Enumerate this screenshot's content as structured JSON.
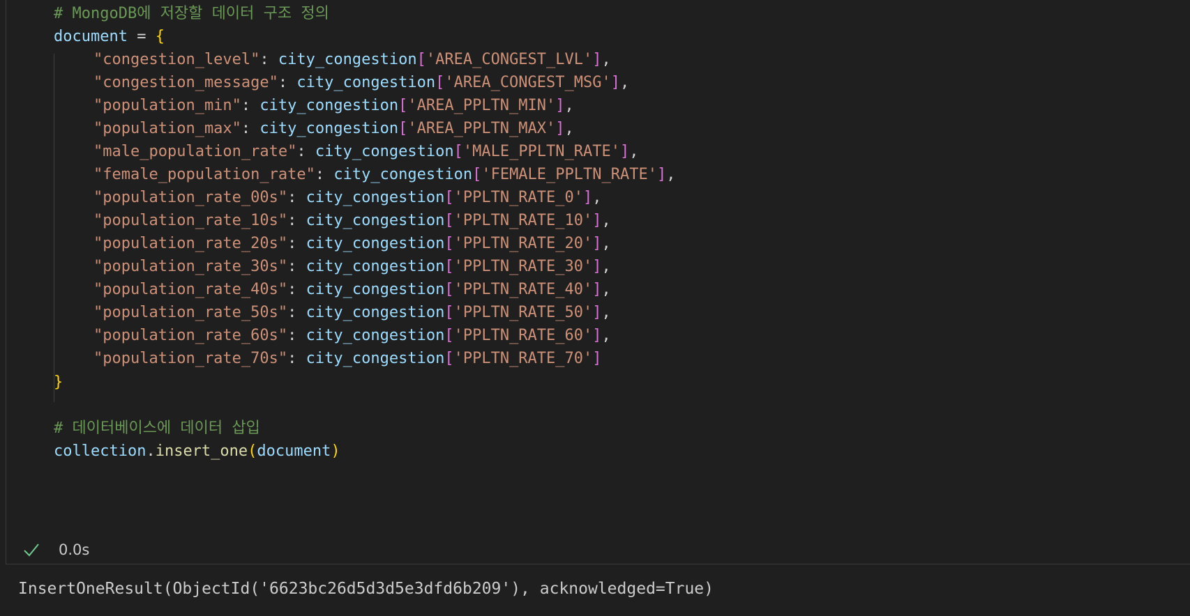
{
  "code": {
    "comment1": "# MongoDB에 저장할 데이터 구조 정의",
    "doc_var": "document",
    "assign": " = ",
    "open_brace": "{",
    "close_brace": "}",
    "func_name": "city_congestion",
    "entries": [
      {
        "key": "\"congestion_level\"",
        "field": "'AREA_CONGEST_LVL'",
        "comma": ","
      },
      {
        "key": "\"congestion_message\"",
        "field": "'AREA_CONGEST_MSG'",
        "comma": ","
      },
      {
        "key": "\"population_min\"",
        "field": "'AREA_PPLTN_MIN'",
        "comma": ","
      },
      {
        "key": "\"population_max\"",
        "field": "'AREA_PPLTN_MAX'",
        "comma": ","
      },
      {
        "key": "\"male_population_rate\"",
        "field": "'MALE_PPLTN_RATE'",
        "comma": ","
      },
      {
        "key": "\"female_population_rate\"",
        "field": "'FEMALE_PPLTN_RATE'",
        "comma": ","
      },
      {
        "key": "\"population_rate_00s\"",
        "field": "'PPLTN_RATE_0'",
        "comma": ","
      },
      {
        "key": "\"population_rate_10s\"",
        "field": "'PPLTN_RATE_10'",
        "comma": ","
      },
      {
        "key": "\"population_rate_20s\"",
        "field": "'PPLTN_RATE_20'",
        "comma": ","
      },
      {
        "key": "\"population_rate_30s\"",
        "field": "'PPLTN_RATE_30'",
        "comma": ","
      },
      {
        "key": "\"population_rate_40s\"",
        "field": "'PPLTN_RATE_40'",
        "comma": ","
      },
      {
        "key": "\"population_rate_50s\"",
        "field": "'PPLTN_RATE_50'",
        "comma": ","
      },
      {
        "key": "\"population_rate_60s\"",
        "field": "'PPLTN_RATE_60'",
        "comma": ","
      },
      {
        "key": "\"population_rate_70s\"",
        "field": "'PPLTN_RATE_70'",
        "comma": ""
      }
    ],
    "comment2": "# 데이터베이스에 데이터 삽입",
    "collection_var": "collection",
    "method": "insert_one",
    "call_arg": "document"
  },
  "status": {
    "icon": "check-icon",
    "duration": "0.0s",
    "color": "#73c991"
  },
  "output": {
    "text": "InsertOneResult(ObjectId('6623bc26d5d3d5e3dfd6b209'), acknowledged=True)"
  },
  "colors": {
    "background": "#1f1f1f",
    "comment": "#6a9955",
    "variable": "#9cdcfe",
    "string": "#ce9178",
    "brace": "#ffd700",
    "bracket": "#da70d6",
    "function": "#dcdcaa"
  }
}
